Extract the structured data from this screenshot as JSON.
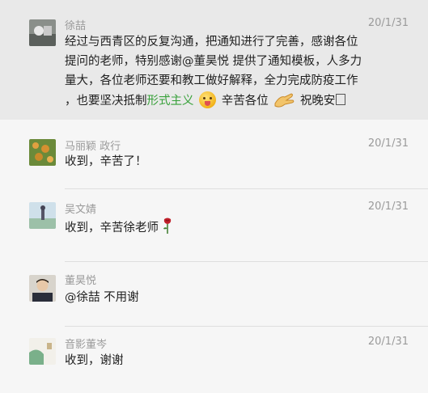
{
  "messages": [
    {
      "name": "徐喆",
      "date": "20/1/31",
      "lines": [
        "经过与西青区的反复沟通，把通知进行了完善，感谢各位",
        "提问的老师，特别感谢@董昊悦 提供了通知模板，人多力",
        "量大，各位老师还要和教工做好解释，全力完成防疫工作"
      ],
      "line4_pre": "，也要坚决抵制",
      "line4_green": "形式主义",
      "line4_mid": "辛苦各位",
      "line4_post": "祝晚安",
      "emoji_face": "grinning-tongue-emoji",
      "emoji_clap": "clapping-hands-emoji"
    },
    {
      "name": "马丽颖 政行",
      "date": "20/1/31",
      "text": "收到，辛苦了！"
    },
    {
      "name": "吴文婧",
      "date": "20/1/31",
      "text": "收到，辛苦徐老师",
      "emoji": "rose-emoji"
    },
    {
      "name": "董昊悦",
      "date": "",
      "text": "@徐喆 不用谢"
    },
    {
      "name": "音影董岑",
      "date": "20/1/31",
      "text": "收到，谢谢"
    }
  ],
  "colors": {
    "highlight_bg": "#e9e9e9",
    "page_bg": "#f6f6f6",
    "green": "#38a13a"
  }
}
